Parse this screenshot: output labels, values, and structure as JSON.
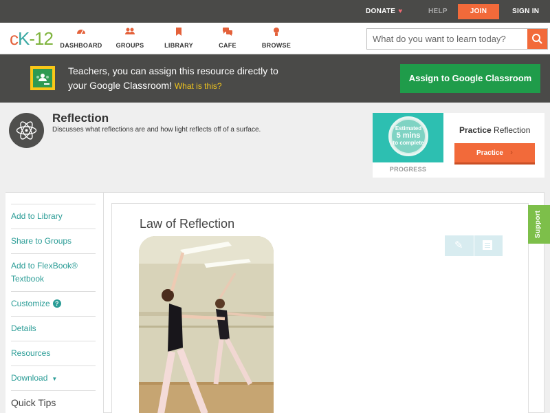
{
  "topbar": {
    "donate_label": "DONATE",
    "help_label": "HELP",
    "join_label": "JOIN",
    "signin_label": "SIGN IN"
  },
  "logo": {
    "text_c": "c",
    "text_k": "K",
    "text_dash": "-",
    "text_12": "12"
  },
  "nav": {
    "items": [
      {
        "label": "DASHBOARD",
        "icon": "dashboard-icon"
      },
      {
        "label": "GROUPS",
        "icon": "groups-icon"
      },
      {
        "label": "LIBRARY",
        "icon": "library-icon"
      },
      {
        "label": "CAFE",
        "icon": "cafe-icon"
      },
      {
        "label": "BROWSE",
        "icon": "browse-icon"
      }
    ]
  },
  "search": {
    "placeholder": "What do you want to learn today?"
  },
  "banner": {
    "line1": "Teachers, you can assign this resource directly to",
    "line2": "your Google Classroom!",
    "what_link": "What is this?",
    "button_label": "Assign to Google Classroom"
  },
  "resource": {
    "title": "Reflection",
    "description": "Discusses what reflections are and how light reflects off of a surface."
  },
  "practice": {
    "estimate_line1": "Estimated",
    "estimate_line2": "5 mins",
    "estimate_line3": "to complete",
    "progress_label": "PROGRESS",
    "title_bold": "Practice",
    "title_rest": "Reflection",
    "button_label": "Practice"
  },
  "sidebar": {
    "items": [
      {
        "label": "Add to Library"
      },
      {
        "label": "Share to Groups"
      },
      {
        "label": "Add to FlexBook® Textbook"
      },
      {
        "label": "Customize"
      },
      {
        "label": "Details"
      },
      {
        "label": "Resources"
      },
      {
        "label": "Download"
      },
      {
        "label": "Quick Tips"
      }
    ]
  },
  "article": {
    "title": "Law of Reflection"
  },
  "support": {
    "label": "Support"
  },
  "colors": {
    "accent": "#f26a3a",
    "teal": "#2a9c96",
    "dark_bar": "#4a4a48",
    "google_green": "#1f9c4a",
    "support_green": "#7dbf4a"
  }
}
